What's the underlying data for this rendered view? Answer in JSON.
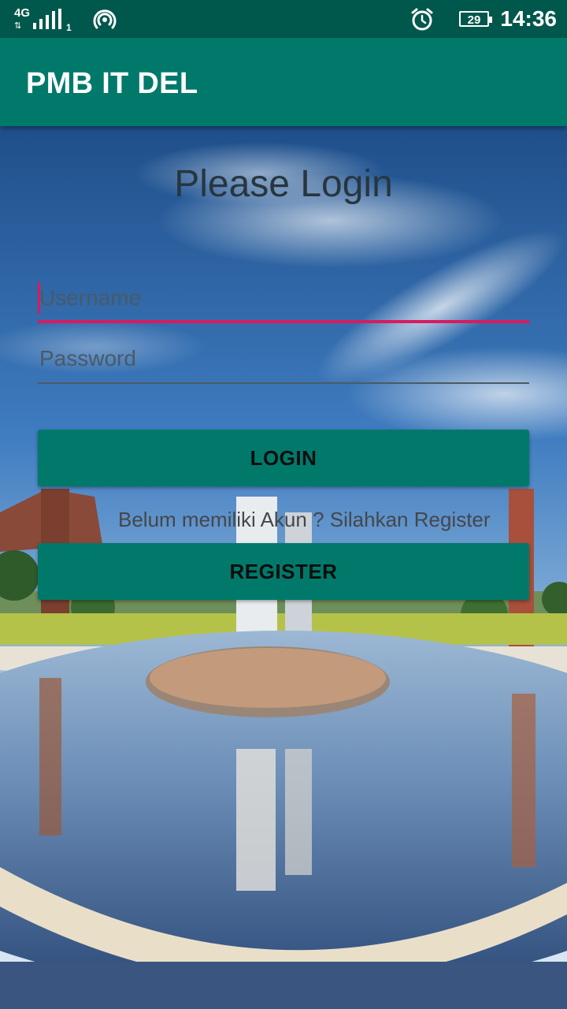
{
  "status_bar": {
    "network_type": "4G",
    "sim_slot": "1",
    "battery_level": "29",
    "time": "14:36",
    "icons": [
      "signal-icon",
      "hotspot-icon",
      "alarm-icon",
      "battery-icon"
    ]
  },
  "app_bar": {
    "title": "PMB IT DEL"
  },
  "login": {
    "heading": "Please Login",
    "username_placeholder": "Username",
    "username_value": "",
    "password_placeholder": "Password",
    "password_value": "",
    "login_button": "LOGIN",
    "register_hint": "Belum memiliki Akun ? Silahkan Register",
    "register_button": "REGISTER"
  },
  "colors": {
    "status_bar": "#00574b",
    "primary": "#00796b",
    "accent": "#d81b60"
  }
}
